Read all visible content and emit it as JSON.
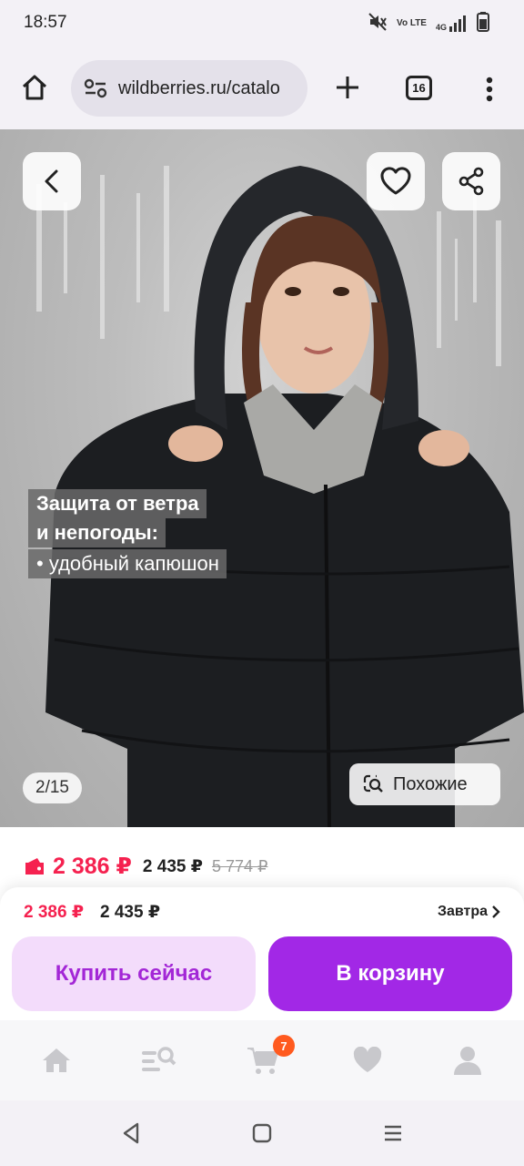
{
  "status_bar": {
    "time": "18:57",
    "network_label": "Vo LTE",
    "signal_label": "4G"
  },
  "browser": {
    "url": "wildberries.ru/catalo",
    "tab_count": "16"
  },
  "product_image": {
    "promo_title_line1": "Защита от ветра",
    "promo_title_line2": "и непогоды:",
    "promo_bullet": "• удобный капюшон",
    "counter": "2/15",
    "similar_label": "Похожие"
  },
  "price": {
    "main": "2 386 ₽",
    "second": "2 435 ₽",
    "old": "5 774 ₽"
  },
  "sheet": {
    "price_main": "2 386 ₽",
    "price_second": "2 435 ₽",
    "delivery": "Завтра",
    "buy_now_label": "Купить сейчас",
    "add_to_cart_label": "В корзину"
  },
  "bottom_nav": {
    "cart_badge": "7"
  },
  "colors": {
    "brand_purple": "#a228e6",
    "price_red": "#f5214f",
    "badge_orange": "#ff5a1f"
  }
}
